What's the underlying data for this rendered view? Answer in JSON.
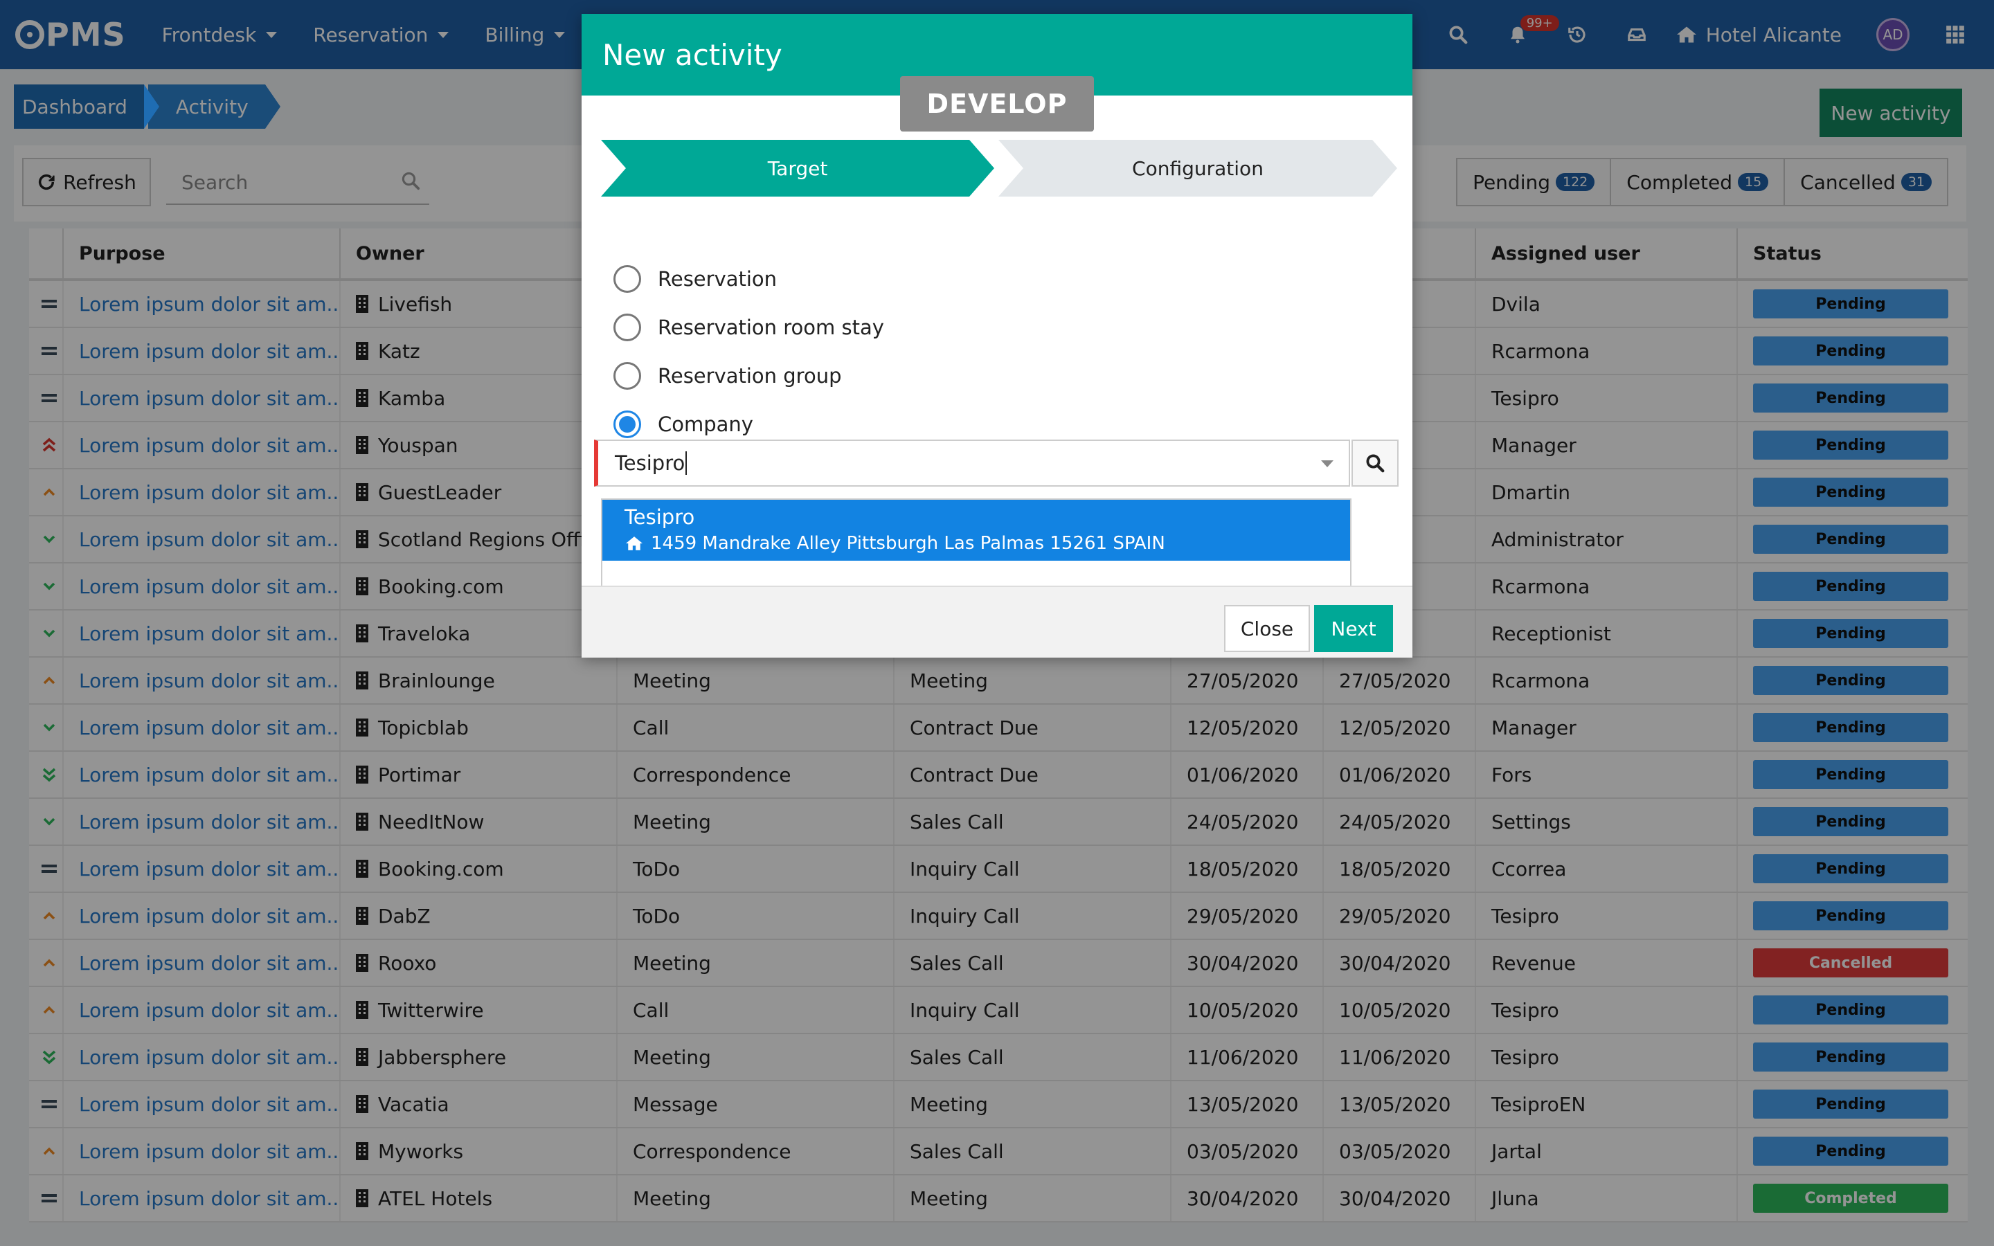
{
  "app": {
    "logo": "PMS"
  },
  "nav": {
    "items": [
      {
        "label": "Frontdesk"
      },
      {
        "label": "Reservation"
      },
      {
        "label": "Billing"
      }
    ],
    "notifications_badge": "99+",
    "hotel_name": "Hotel Alicante",
    "avatar_initials": "AD"
  },
  "breadcrumb": [
    "Dashboard",
    "Activity"
  ],
  "page": {
    "new_activity_label": "New activity"
  },
  "toolbar": {
    "refresh_label": "Refresh",
    "search_placeholder": "Search",
    "filters": [
      {
        "label": "Pending",
        "count": "122"
      },
      {
        "label": "Completed",
        "count": "15"
      },
      {
        "label": "Cancelled",
        "count": "31"
      }
    ]
  },
  "table": {
    "headers": {
      "purpose": "Purpose",
      "owner": "Owner",
      "assigned_user": "Assigned user",
      "status": "Status"
    },
    "rows": [
      {
        "priority": "normal",
        "purpose": "Lorem ipsum dolor sit am...",
        "owner": "Livefish",
        "type": "",
        "subtype": "",
        "start": "",
        "end": "",
        "user": "Dvila",
        "status": "Pending"
      },
      {
        "priority": "normal",
        "purpose": "Lorem ipsum dolor sit am...",
        "owner": "Katz",
        "type": "",
        "subtype": "",
        "start": "",
        "end": "",
        "user": "Rcarmona",
        "status": "Pending"
      },
      {
        "priority": "normal",
        "purpose": "Lorem ipsum dolor sit am...",
        "owner": "Kamba",
        "type": "",
        "subtype": "",
        "start": "",
        "end": "",
        "user": "Tesipro",
        "status": "Pending"
      },
      {
        "priority": "urgent",
        "purpose": "Lorem ipsum dolor sit am...",
        "owner": "Youspan",
        "type": "",
        "subtype": "",
        "start": "",
        "end": "",
        "user": "Manager",
        "status": "Pending"
      },
      {
        "priority": "high",
        "purpose": "Lorem ipsum dolor sit am...",
        "owner": "GuestLeader",
        "type": "",
        "subtype": "",
        "start": "",
        "end": "",
        "user": "Dmartin",
        "status": "Pending"
      },
      {
        "priority": "low",
        "purpose": "Lorem ipsum dolor sit am...",
        "owner": "Scotland Regions Offic",
        "type": "",
        "subtype": "",
        "start": "",
        "end": "",
        "user": "Administrator",
        "status": "Pending"
      },
      {
        "priority": "low",
        "purpose": "Lorem ipsum dolor sit am...",
        "owner": "Booking.com",
        "type": "",
        "subtype": "",
        "start": "",
        "end": "",
        "user": "Rcarmona",
        "status": "Pending"
      },
      {
        "priority": "low",
        "purpose": "Lorem ipsum dolor sit am...",
        "owner": "Traveloka",
        "type": "",
        "subtype": "",
        "start": "",
        "end": "",
        "user": "Receptionist",
        "status": "Pending"
      },
      {
        "priority": "high",
        "purpose": "Lorem ipsum dolor sit am...",
        "owner": "Brainlounge",
        "type": "Meeting",
        "subtype": "Meeting",
        "start": "27/05/2020",
        "end": "27/05/2020",
        "user": "Rcarmona",
        "status": "Pending"
      },
      {
        "priority": "low",
        "purpose": "Lorem ipsum dolor sit am...",
        "owner": "Topicblab",
        "type": "Call",
        "subtype": "Contract Due",
        "start": "12/05/2020",
        "end": "12/05/2020",
        "user": "Manager",
        "status": "Pending"
      },
      {
        "priority": "lowest",
        "purpose": "Lorem ipsum dolor sit am...",
        "owner": "Portimar",
        "type": "Correspondence",
        "subtype": "Contract Due",
        "start": "01/06/2020",
        "end": "01/06/2020",
        "user": "Fors",
        "status": "Pending"
      },
      {
        "priority": "low",
        "purpose": "Lorem ipsum dolor sit am...",
        "owner": "NeedItNow",
        "type": "Meeting",
        "subtype": "Sales Call",
        "start": "24/05/2020",
        "end": "24/05/2020",
        "user": "Settings",
        "status": "Pending"
      },
      {
        "priority": "normal",
        "purpose": "Lorem ipsum dolor sit am...",
        "owner": "Booking.com",
        "type": "ToDo",
        "subtype": "Inquiry Call",
        "start": "18/05/2020",
        "end": "18/05/2020",
        "user": "Ccorrea",
        "status": "Pending"
      },
      {
        "priority": "high",
        "purpose": "Lorem ipsum dolor sit am...",
        "owner": "DabZ",
        "type": "ToDo",
        "subtype": "Inquiry Call",
        "start": "29/05/2020",
        "end": "29/05/2020",
        "user": "Tesipro",
        "status": "Pending"
      },
      {
        "priority": "high",
        "purpose": "Lorem ipsum dolor sit am...",
        "owner": "Rooxo",
        "type": "Meeting",
        "subtype": "Sales Call",
        "start": "30/04/2020",
        "end": "30/04/2020",
        "user": "Revenue",
        "status": "Cancelled"
      },
      {
        "priority": "high",
        "purpose": "Lorem ipsum dolor sit am...",
        "owner": "Twitterwire",
        "type": "Call",
        "subtype": "Inquiry Call",
        "start": "10/05/2020",
        "end": "10/05/2020",
        "user": "Tesipro",
        "status": "Pending"
      },
      {
        "priority": "lowest",
        "purpose": "Lorem ipsum dolor sit am...",
        "owner": "Jabbersphere",
        "type": "Meeting",
        "subtype": "Sales Call",
        "start": "11/06/2020",
        "end": "11/06/2020",
        "user": "Tesipro",
        "status": "Pending"
      },
      {
        "priority": "normal",
        "purpose": "Lorem ipsum dolor sit am...",
        "owner": "Vacatia",
        "type": "Message",
        "subtype": "Meeting",
        "start": "13/05/2020",
        "end": "13/05/2020",
        "user": "TesiproEN",
        "status": "Pending"
      },
      {
        "priority": "high",
        "purpose": "Lorem ipsum dolor sit am...",
        "owner": "Myworks",
        "type": "Correspondence",
        "subtype": "Sales Call",
        "start": "03/05/2020",
        "end": "03/05/2020",
        "user": "Jartal",
        "status": "Pending"
      },
      {
        "priority": "normal",
        "purpose": "Lorem ipsum dolor sit am...",
        "owner": "ATEL Hotels",
        "type": "Meeting",
        "subtype": "Meeting",
        "start": "30/04/2020",
        "end": "30/04/2020",
        "user": "Jluna",
        "status": "Completed"
      }
    ]
  },
  "modal": {
    "title": "New activity",
    "env_badge": "DEVELOP",
    "steps": [
      {
        "label": "Target"
      },
      {
        "label": "Configuration"
      }
    ],
    "options": [
      {
        "label": "Reservation",
        "checked": false
      },
      {
        "label": "Reservation room stay",
        "checked": false
      },
      {
        "label": "Reservation group",
        "checked": false
      },
      {
        "label": "Company",
        "checked": true
      }
    ],
    "company_input": {
      "value": "Tesipro"
    },
    "dropdown_option": {
      "name": "Tesipro",
      "address": "1459 Mandrake Alley Pittsburgh Las Palmas 15261 SPAIN"
    },
    "close_label": "Close",
    "next_label": "Next"
  },
  "colors": {
    "nav_blue": "#1f5fa6",
    "teal": "#00a896",
    "pending": "#4aa3ef",
    "cancelled": "#e03b3b",
    "completed": "#2eb85c"
  }
}
